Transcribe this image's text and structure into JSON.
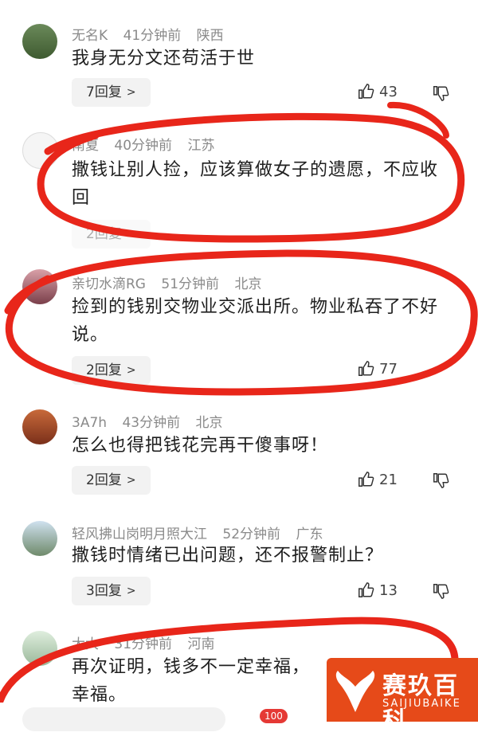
{
  "comments": [
    {
      "user": "无名K",
      "time": "41分钟前",
      "location": "陕西",
      "text": "我身无分文还苟活于世",
      "replies": "7回复",
      "likes": "43"
    },
    {
      "user": "南夏",
      "time": "40分钟前",
      "location": "江苏",
      "text": "撒钱让别人捡，应该算做女子的遗愿，不应收回",
      "replies": "2回复",
      "likes": ""
    },
    {
      "user": "亲切水滴RG",
      "time": "51分钟前",
      "location": "北京",
      "text": "捡到的钱别交物业交派出所。物业私吞了不好说。",
      "replies": "2回复",
      "likes": "77"
    },
    {
      "user": "3A7h",
      "time": "43分钟前",
      "location": "北京",
      "text": "怎么也得把钱花完再干傻事呀！",
      "replies": "2回复",
      "likes": "21"
    },
    {
      "user": "轻风拂山岗明月照大江",
      "time": "52分钟前",
      "location": "广东",
      "text": "撒钱时情绪已出问题，还不报警制止？",
      "replies": "3回复",
      "likes": "13"
    },
    {
      "user": "大大",
      "time": "31分钟前",
      "location": "河南",
      "text": "再次证明，钱多不一定幸福，\n幸福。",
      "replies": "",
      "likes": ""
    }
  ],
  "bottom": {
    "badge": "100"
  },
  "watermark": {
    "cn": "赛玖百科",
    "en": "SAIJIUBAIKE"
  },
  "colors": {
    "annotation": "#e8261a",
    "watermark": "#e64a19",
    "meta": "#8a8a8a"
  }
}
